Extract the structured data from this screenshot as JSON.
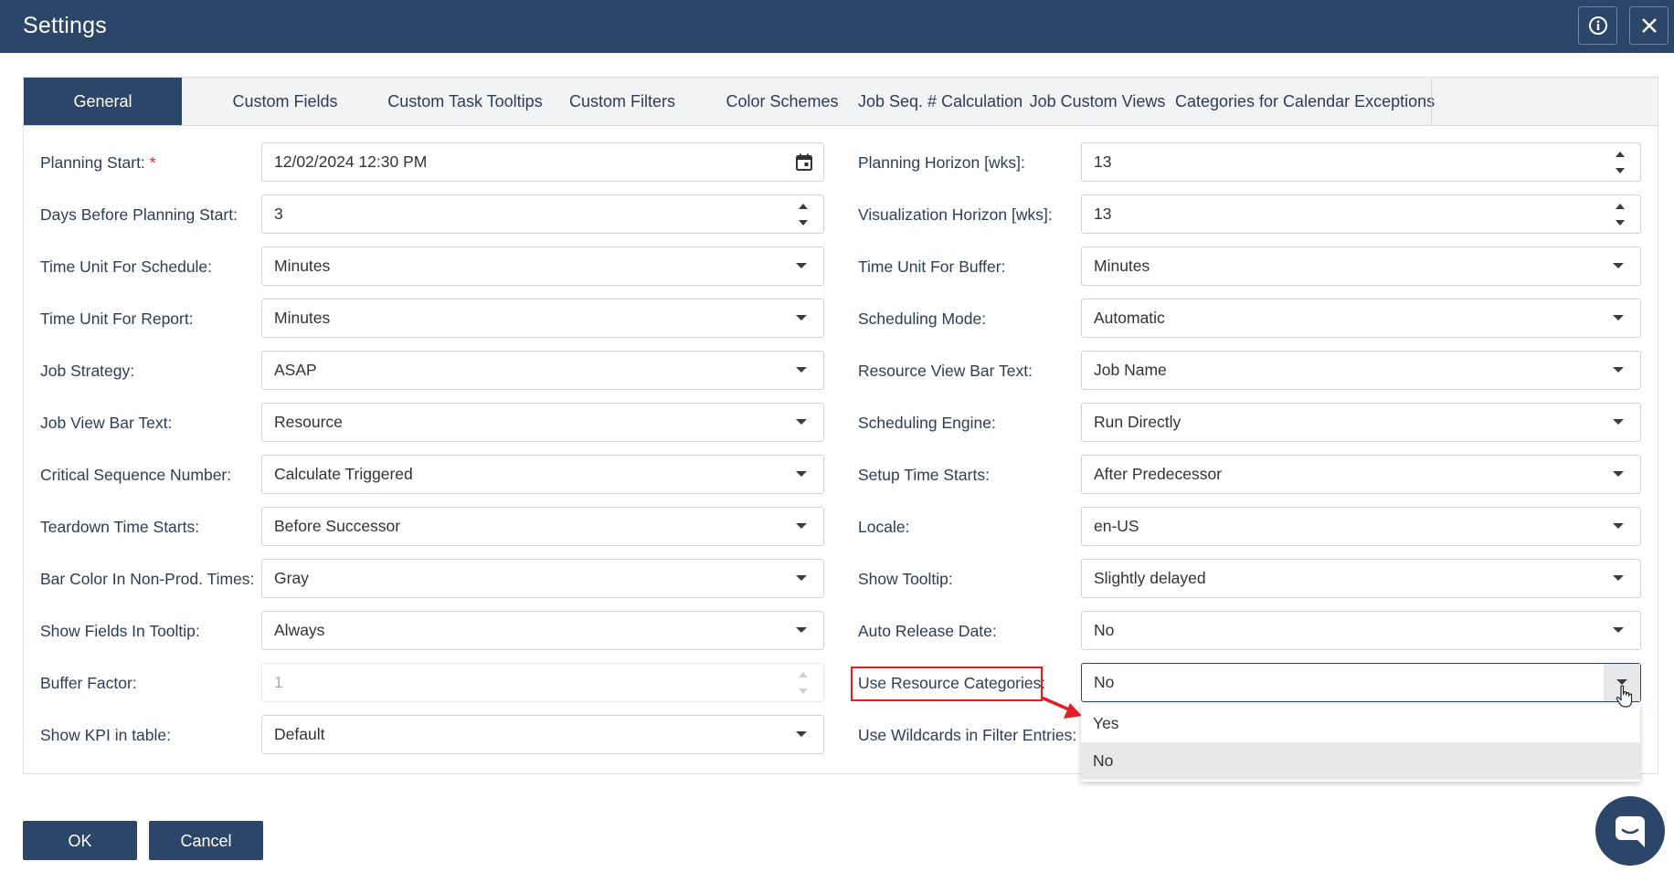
{
  "window": {
    "title": "Settings",
    "info_icon": "info-circle-icon",
    "close_icon": "close-icon"
  },
  "tabs": [
    {
      "label": "General",
      "active": true
    },
    {
      "label": "Custom Fields"
    },
    {
      "label": "Custom Task Tooltips"
    },
    {
      "label": "Custom Filters"
    },
    {
      "label": "Color Schemes"
    },
    {
      "label": "Job Seq. # Calculation"
    },
    {
      "label": "Job Custom Views"
    },
    {
      "label": "Categories for Calendar Exceptions"
    }
  ],
  "left": {
    "planning_start": {
      "label": "Planning Start:",
      "required_mark": "*",
      "value": "12/02/2024 12:30 PM"
    },
    "days_before": {
      "label": "Days Before Planning Start:",
      "value": "3"
    },
    "time_unit_schedule": {
      "label": "Time Unit For Schedule:",
      "value": "Minutes"
    },
    "time_unit_report": {
      "label": "Time Unit For Report:",
      "value": "Minutes"
    },
    "job_strategy": {
      "label": "Job Strategy:",
      "value": "ASAP"
    },
    "job_view_bar_text": {
      "label": "Job View Bar Text:",
      "value": "Resource"
    },
    "critical_seq": {
      "label": "Critical Sequence Number:",
      "value": "Calculate Triggered"
    },
    "teardown": {
      "label": "Teardown Time Starts:",
      "value": "Before Successor"
    },
    "bar_color": {
      "label": "Bar Color In Non-Prod. Times:",
      "value": "Gray"
    },
    "show_fields": {
      "label": "Show Fields In Tooltip:",
      "value": "Always"
    },
    "buffer_factor": {
      "label": "Buffer Factor:",
      "value": "1"
    },
    "show_kpi": {
      "label": "Show KPI in table:",
      "value": "Default"
    }
  },
  "right": {
    "planning_horizon": {
      "label": "Planning Horizon [wks]:",
      "value": "13"
    },
    "visualization_horizon": {
      "label": "Visualization Horizon [wks]:",
      "value": "13"
    },
    "time_unit_buffer": {
      "label": "Time Unit For Buffer:",
      "value": "Minutes"
    },
    "scheduling_mode": {
      "label": "Scheduling Mode:",
      "value": "Automatic"
    },
    "resource_view_bar": {
      "label": "Resource View Bar Text:",
      "value": "Job Name"
    },
    "scheduling_engine": {
      "label": "Scheduling Engine:",
      "value": "Run Directly"
    },
    "setup_time": {
      "label": "Setup Time Starts:",
      "value": "After Predecessor"
    },
    "locale": {
      "label": "Locale:",
      "value": "en-US"
    },
    "show_tooltip": {
      "label": "Show Tooltip:",
      "value": "Slightly delayed"
    },
    "auto_release": {
      "label": "Auto Release Date:",
      "value": "No"
    },
    "use_resource_categories": {
      "label": "Use Resource Categories:",
      "value": "No"
    },
    "use_wildcards": {
      "label": "Use Wildcards in Filter Entries:"
    }
  },
  "dropdown": {
    "options": [
      "Yes",
      "No"
    ],
    "selected": "No"
  },
  "footer": {
    "ok": "OK",
    "cancel": "Cancel"
  },
  "colors": {
    "primary": "#2b4668",
    "highlight": "#e01f25"
  }
}
